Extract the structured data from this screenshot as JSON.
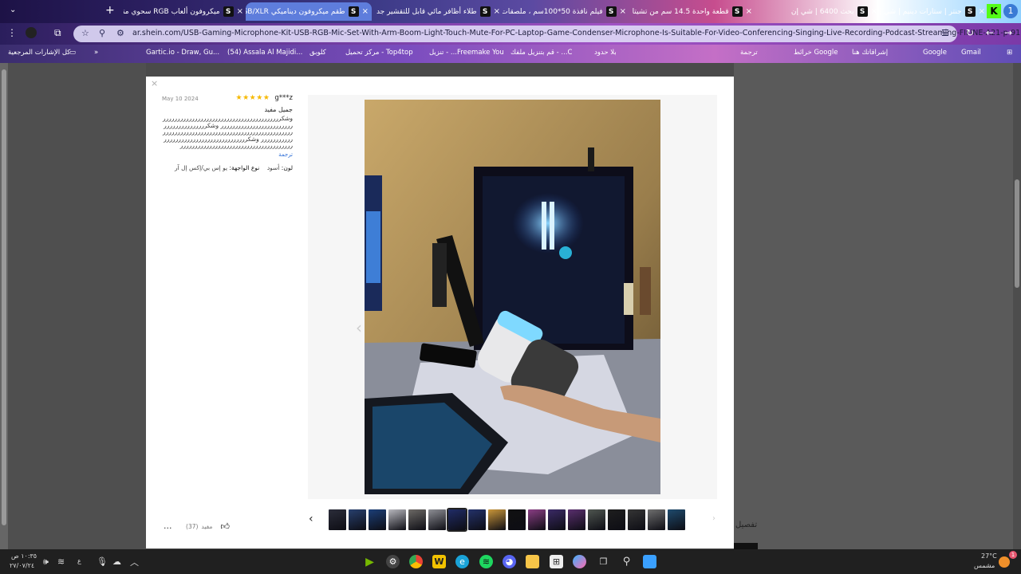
{
  "browser": {
    "tabs": [
      {
        "title": "جنتر | ستارات دينيم | شي إن الشرق",
        "active": false
      },
      {
        "title": "بحث 6400 | شي إن",
        "active": false
      },
      {
        "title": "قطعة واحدة 14.5 سم من تشيتا",
        "active": false
      },
      {
        "title": "فيلم نافذة 50*100سم ، ملصقات",
        "active": false
      },
      {
        "title": "طلاء أظافر مائي قابل للتقشير جد",
        "active": false
      },
      {
        "title": "طقم ميكروفون ديناميكي USB/XLR",
        "active": true
      },
      {
        "title": "ميكروفون ألعاب RGB سحوي متد",
        "active": false
      }
    ],
    "new_tab": "+",
    "url": "ar.shein.com/USB-Gaming-Microphone-Kit-USB-RGB-Mic-Set-With-Arm-Boom-Light-Touch-Mute-For-PC-Laptop-Game-Condenser-Microphone-Is-Suitable-For-Video-Conferencing-Singing-Live-Recording-Podcast-Streaming-FIFINE-A21-p-91...",
    "bookmarks": [
      "كل الإشارات المرجعية",
      "Gartic.io - Draw, Gu...",
      "(54) Assala Al Majidi...",
      "كلوبق",
      "Top4top - مركز تحميل",
      "Freemake You... - تنزيل",
      "C... - قم بتنزيل ملفك",
      "بلا حدود",
      "ترجمة",
      "Google خرائط",
      "إشراقاتك هنا",
      "Google",
      "Gmail"
    ]
  },
  "review": {
    "user": "g***z",
    "stars": "★★★★★",
    "date": "May 10 2024",
    "title": "جميل مفيد",
    "body": "وشكرررررررررررررررررررررررررررررررررررررررررررررررررررررررررررررررررر وشكررررررررررررررررررررررررررررررررررررررررررررررررررررررررررررررررررررررر وشكرررررررررررررررررررررررررررررررررررررررررررررررررررررررررررررررررررر",
    "translate": "ترجمة",
    "color_label": "لون:",
    "color_value": "أسود",
    "interface_label": "نوع الواجهة:",
    "interface_value": "يو إس بي/إكس إل آر",
    "helpful_label": "مفيد",
    "helpful_count": "(37)",
    "more": "···"
  },
  "gallery": {
    "thumb_count": 18,
    "selected_index": 6
  },
  "background_page": {
    "detail_label": "تفصيل"
  },
  "taskbar": {
    "temp": "27°C",
    "weather": "مشمس",
    "time": "١٠:٣٥ ص",
    "date": "٢٧/٠٧/٢٤"
  }
}
